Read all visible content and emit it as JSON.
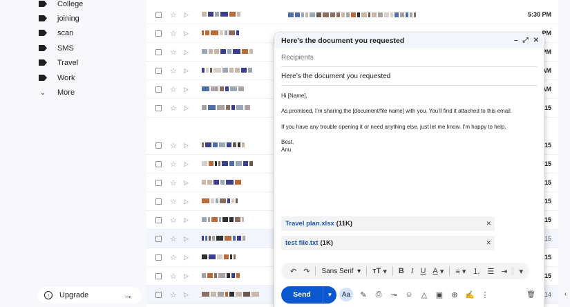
{
  "sidebar": {
    "labels": [
      {
        "label": "College"
      },
      {
        "label": "joining"
      },
      {
        "label": "scan"
      },
      {
        "label": "SMS"
      },
      {
        "label": "Travel"
      },
      {
        "label": "Work"
      }
    ],
    "more_label": "More",
    "upgrade_label": "Upgrade"
  },
  "maillist": {
    "rows": [
      {
        "time": "5:30 PM",
        "read": false
      },
      {
        "time": "PM",
        "read": false
      },
      {
        "time": "PM",
        "read": false
      },
      {
        "time": "AM",
        "read": false
      },
      {
        "time": "AM",
        "read": false
      },
      {
        "time": "15",
        "read": false
      },
      {
        "time": "15",
        "read": false
      },
      {
        "time": "15",
        "read": false
      },
      {
        "time": "15",
        "read": false
      },
      {
        "time": "15",
        "read": false
      },
      {
        "time": "15",
        "read": false
      },
      {
        "time": "15",
        "read": true
      },
      {
        "time": "15",
        "read": false
      },
      {
        "time": "15",
        "read": false
      },
      {
        "time": "14",
        "read": true
      }
    ]
  },
  "compose": {
    "title": "Here’s the document you requested",
    "recipients_placeholder": "Recipients",
    "subject": "Here’s the document you requested",
    "body": {
      "greeting": "Hi [Name],",
      "line1": "As promised, I’m sharing the [document/file name] with you. You’ll find it attached to this email.",
      "line2": "If you have any trouble opening it or need anything else, just let me know. I’m happy to help.",
      "signoff": "Best,",
      "signature": "Anu"
    },
    "attachments": [
      {
        "name": "Travel plan.xlsx",
        "size": "(11K)"
      },
      {
        "name": "test file.txt",
        "size": "(1K)"
      }
    ],
    "format_bar": {
      "font": "Sans Serif"
    },
    "send_label": "Send",
    "aa_label": "Aa"
  },
  "colors": {
    "accent": "#0b57d0",
    "attachment_link": "#1a55b4",
    "sidebar_bg": "#f6f8fc"
  }
}
